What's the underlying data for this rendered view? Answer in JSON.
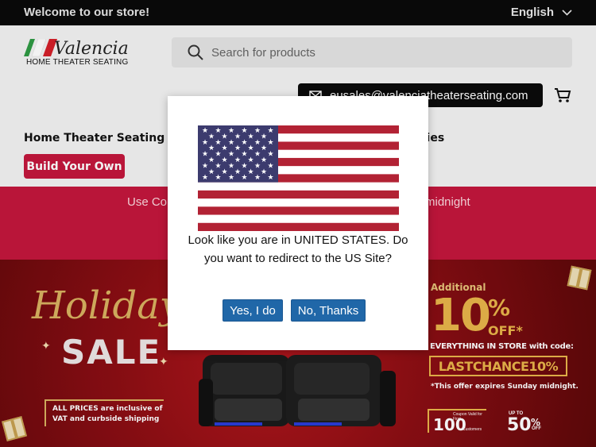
{
  "topbar": {
    "welcome": "Welcome to our store!",
    "language": "English"
  },
  "header": {
    "logo_brand": "Valencia",
    "logo_tagline": "HOME THEATER SEATING",
    "search_placeholder": "Search for products",
    "email": "eusales@valenciatheaterseating.com",
    "nav_home_theater": "Home Theater Seating",
    "nav_accessories": "ories",
    "build_button": "Build Your Own"
  },
  "promo": {
    "text_left": "Use Co",
    "text_right": "midnight"
  },
  "hero": {
    "holiday": "Holiday",
    "sale": "SALE",
    "all_prices": "ALL PRICES are inclusive of VAT and curbside shipping",
    "additional": "Additional",
    "ten": "10",
    "percent": "%",
    "off": "OFF*",
    "everything": "EVERYTHING IN STORE with code:",
    "code": "LASTCHANCE10%",
    "expires": "*This offer expires Sunday midnight.",
    "coupon_small": "Coupon Valid for First",
    "coupon_num": "100",
    "coupon_customers": "Customers",
    "upto": "UP TO",
    "fifty": "50",
    "fifty_pct": "%",
    "fifty_off": "OFF"
  },
  "modal": {
    "message": "Look like you are in UNITED STATES. Do you want to redirect to the US Site?",
    "yes_label": "Yes, I do",
    "no_label": "No, Thanks"
  },
  "colors": {
    "accent_red": "#c3173d",
    "button_blue": "#2067a8",
    "gold": "#e8b54a"
  }
}
